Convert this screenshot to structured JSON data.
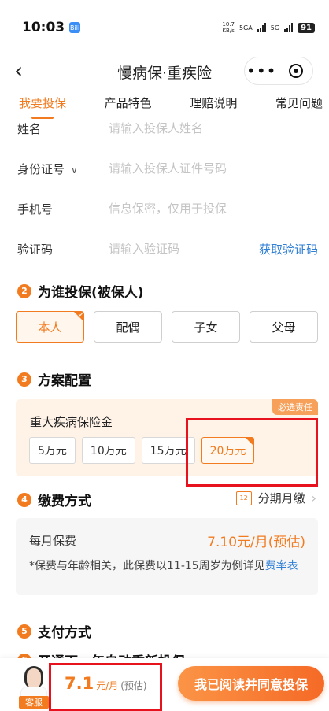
{
  "status_bar": {
    "time": "10:03",
    "app_badge": "Bili",
    "net_speed_value": "10.7",
    "net_speed_unit": "KB/s",
    "signal1_label": "5GA",
    "signal2_label": "5G",
    "battery": "91"
  },
  "nav": {
    "back": "‹",
    "title": "慢病保·重疾险",
    "more": "•••"
  },
  "tabs": [
    {
      "label": "我要投保",
      "active": true
    },
    {
      "label": "产品特色",
      "active": false
    },
    {
      "label": "理赔说明",
      "active": false
    },
    {
      "label": "常见问题",
      "active": false
    }
  ],
  "form": {
    "name_label": "姓名",
    "name_placeholder": "请输入投保人姓名",
    "id_label": "身份证号",
    "id_chevron": "∨",
    "id_placeholder": "请输入投保人证件号码",
    "phone_label": "手机号",
    "phone_placeholder": "信息保密，仅用于投保",
    "code_label": "验证码",
    "code_placeholder": "请输入验证码",
    "get_code": "获取验证码"
  },
  "insured_section": {
    "num": "2",
    "title": "为谁投保(被保人)",
    "options": [
      {
        "label": "本人",
        "selected": true
      },
      {
        "label": "配偶",
        "selected": false
      },
      {
        "label": "子女",
        "selected": false
      },
      {
        "label": "父母",
        "selected": false
      }
    ]
  },
  "plan_section": {
    "num": "3",
    "title": "方案配置",
    "required_badge": "必选责任",
    "coverage_title": "重大疾病保险金",
    "amounts": [
      {
        "label": "5万元",
        "selected": false
      },
      {
        "label": "10万元",
        "selected": false
      },
      {
        "label": "15万元",
        "selected": false
      },
      {
        "label": "20万元",
        "selected": true
      }
    ]
  },
  "payment_section": {
    "num": "4",
    "title": "缴费方式",
    "calendar_icon_text": "12",
    "mode": "分期月缴",
    "arrow": "›",
    "monthly_label": "每月保费",
    "monthly_value": "7.10元/月(预估)",
    "note": "*保费与年龄相关，此保费以11-15周岁为例详见",
    "rate_link": "费率表"
  },
  "pay_method_section": {
    "num": "5",
    "title": "支付方式"
  },
  "renew_section": {
    "num": "6",
    "title": "开通下一年自动重新投保"
  },
  "bottom_bar": {
    "customer_service": "客服",
    "price": "7.1",
    "unit": "元/月",
    "estimate": "(预估)",
    "cta": "我已阅读并同意投保"
  },
  "colors": {
    "accent": "#f27b1f",
    "link": "#2f7fd6",
    "highlight_box": "#e8121f"
  }
}
